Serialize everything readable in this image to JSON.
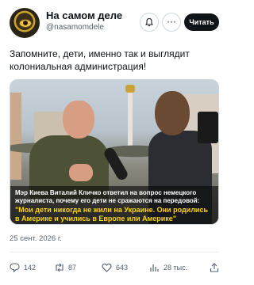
{
  "account": {
    "display_name": "На самом деле",
    "handle": "@nasamomdele"
  },
  "header": {
    "follow_label": "Читать",
    "more_label": "···"
  },
  "tweet": {
    "text": "Запомните, дети, именно так и выглядит колониальная администрация!",
    "date": "25 сент. 2026 г."
  },
  "media": {
    "caption_white": "Мэр Киева Виталий Кличко ответил на вопрос немецкого журналиста, почему его дети не сражаются на передовой:",
    "caption_yellow": "\"Мои дети никогда не жили на Украине. Они родились в Америке и учились в Европе или Америке\""
  },
  "actions": {
    "replies": "142",
    "retweets": "87",
    "likes": "643",
    "views": "28 тыс."
  },
  "colors": {
    "caption_highlight": "#ffd400",
    "secondary_text": "#536471",
    "follow_button": "#0f1419"
  },
  "icons": [
    "avatar-logo",
    "bell-plus-icon",
    "more-icon",
    "reply-icon",
    "retweet-icon",
    "like-icon",
    "views-icon",
    "share-icon"
  ]
}
